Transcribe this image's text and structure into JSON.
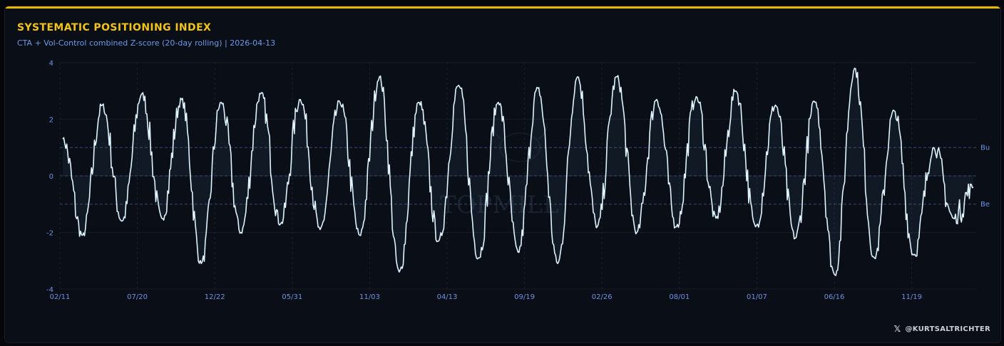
{
  "header": {
    "title": "SYSTEMATIC POSITIONING INDEX",
    "subtitle": "CTA + Vol-Control combined Z-score (20-day rolling) | 2026-04-13"
  },
  "credit": {
    "icon": "x-logo-icon",
    "handle": "@KURTSALTRICHTER"
  },
  "watermark": {
    "text": "TOPMILL"
  },
  "colors": {
    "accent": "#e8b800",
    "title": "#f2c417",
    "line": "#dff4ff",
    "tick": "#6f93e0",
    "background": "#0a0e17"
  },
  "chart_data": {
    "type": "line",
    "title": "SYSTEMATIC POSITIONING INDEX",
    "xlabel": "",
    "ylabel": "",
    "ylim": [
      -4,
      4
    ],
    "yticks": [
      "4",
      "2",
      "0",
      "-2",
      "-4"
    ],
    "ytick_values": [
      4,
      2,
      0,
      -2,
      -4
    ],
    "xticks": [
      "02/11",
      "07/20",
      "12/22",
      "05/31",
      "11/03",
      "04/13",
      "09/19",
      "02/26",
      "08/01",
      "01/07",
      "06/16",
      "11/19"
    ],
    "reference_lines": [
      {
        "value": 1,
        "label": "Bu"
      },
      {
        "value": 0,
        "label": ""
      },
      {
        "value": -1,
        "label": "Be"
      }
    ],
    "grid": true,
    "series": [
      {
        "values": [
          1.3,
          -2.1,
          2.5,
          -1.6,
          2.9,
          -1.5,
          2.7,
          -3.1,
          2.6,
          -2.0,
          2.9,
          -1.7,
          2.7,
          -1.9,
          2.6,
          -2.1,
          3.5,
          -3.4,
          2.6,
          -2.3,
          3.2,
          -2.9,
          2.6,
          -2.7,
          3.1,
          -3.1,
          3.5,
          -1.8,
          3.5,
          -2.0,
          2.7,
          -1.8,
          2.8,
          -1.5,
          3.0,
          -1.8,
          2.5,
          -2.2,
          2.6,
          -3.5,
          3.8,
          -2.9,
          2.3,
          -2.8,
          1.0,
          -1.5,
          -0.4
        ]
      }
    ]
  }
}
